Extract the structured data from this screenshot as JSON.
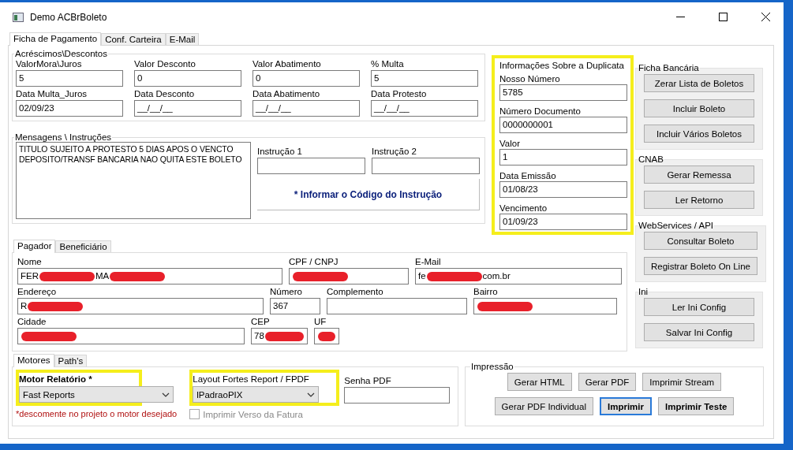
{
  "window": {
    "title": "Demo ACBrBoleto"
  },
  "tabs": [
    {
      "label": "Ficha de Pagamento",
      "selected": true
    },
    {
      "label": "Conf. Carteira",
      "selected": false
    },
    {
      "label": "E-Mail",
      "selected": false
    }
  ],
  "acrescimos": {
    "title": "Acréscimos\\Descontos",
    "fields": [
      {
        "label": "ValorMora\\Juros",
        "value": "5"
      },
      {
        "label": "Valor Desconto",
        "value": "0"
      },
      {
        "label": "Valor Abatimento",
        "value": "0"
      },
      {
        "label": "% Multa",
        "value": "5"
      },
      {
        "label": "Data Multa_Juros",
        "value": "02/09/23"
      },
      {
        "label": "Data Desconto",
        "value": "__/__/__"
      },
      {
        "label": "Data Abatimento",
        "value": "__/__/__"
      },
      {
        "label": "Data Protesto",
        "value": "__/__/__"
      }
    ]
  },
  "mensagens": {
    "title": "Mensagens \\ Instruções",
    "lines": [
      "TITULO SUJEITO A PROTESTO 5 DIAS APOS O VENCTO",
      "DEPOSITO/TRANSF BANCARIA NAO QUITA ESTE BOLETO"
    ],
    "instrucoes": [
      {
        "label": "Instrução 1"
      },
      {
        "label": "Instrução 2"
      }
    ],
    "note": "* Informar o Código do Instrução"
  },
  "duplicata": {
    "title": "Informações Sobre a Duplicata",
    "highlighted": true,
    "fields": [
      {
        "label": "Nosso Número",
        "value": "5785"
      },
      {
        "label": "Número Documento",
        "value": "0000000001"
      },
      {
        "label": "Valor",
        "value": "1"
      },
      {
        "label": "Data Emissão",
        "value": "01/08/23"
      },
      {
        "label": "Vencimento",
        "value": "01/09/23"
      }
    ]
  },
  "side_groups": [
    {
      "title": "Ficha Bancária",
      "buttons": [
        "Zerar Lista de Boletos",
        "Incluir Boleto",
        "Incluir Vários Boletos"
      ]
    },
    {
      "title": "CNAB",
      "buttons": [
        "Gerar Remessa",
        "Ler Retorno"
      ]
    },
    {
      "title": "WebServices / API",
      "buttons": [
        "Consultar Boleto",
        "Registrar Boleto On Line"
      ]
    },
    {
      "title": "Ini",
      "buttons": [
        "Ler Ini Config",
        "Salvar Ini Config"
      ]
    }
  ],
  "pagador": {
    "tabs": [
      {
        "label": "Pagador",
        "selected": true
      },
      {
        "label": "Beneficiário",
        "selected": false
      }
    ],
    "fields": [
      {
        "label": "Nome",
        "segments": [
          {
            "kind": "text",
            "text": "FER"
          },
          {
            "kind": "redaction"
          },
          {
            "kind": "text",
            "text": "MA"
          },
          {
            "kind": "redaction"
          }
        ]
      },
      {
        "label": "CPF / CNPJ",
        "segments": [
          {
            "kind": "redaction"
          }
        ]
      },
      {
        "label": "E-Mail",
        "segments": [
          {
            "kind": "text",
            "text": "fe"
          },
          {
            "kind": "redaction"
          },
          {
            "kind": "text",
            "text": "com.br"
          }
        ]
      },
      {
        "label": "Endereço",
        "segments": [
          {
            "kind": "text",
            "text": "R"
          },
          {
            "kind": "redaction"
          }
        ]
      },
      {
        "label": "Número",
        "segments": [
          {
            "kind": "text",
            "text": "367"
          }
        ]
      },
      {
        "label": "Complemento"
      },
      {
        "label": "Bairro",
        "segments": [
          {
            "kind": "redaction"
          }
        ]
      },
      {
        "label": "Cidade",
        "segments": [
          {
            "kind": "redaction"
          }
        ]
      },
      {
        "label": "CEP",
        "segments": [
          {
            "kind": "text",
            "text": "78"
          },
          {
            "kind": "redaction"
          }
        ]
      },
      {
        "label": "UF",
        "segments": [
          {
            "kind": "redaction"
          }
        ]
      }
    ]
  },
  "motores": {
    "tabs": [
      {
        "label": "Motores",
        "selected": true
      },
      {
        "label": "Path's",
        "selected": false
      }
    ],
    "motor": {
      "label": "Motor Relatório *",
      "value": "Fast Reports",
      "highlighted": true
    },
    "hint": "*descomente no projeto o motor desejado",
    "layout": {
      "label": "Layout Fortes Report / FPDF",
      "value": "lPadraoPIX",
      "highlighted": true
    },
    "senha": {
      "label": "Senha PDF"
    },
    "verso": {
      "label": "Imprimir Verso da Fatura",
      "checked": false
    }
  },
  "impressao": {
    "title": "Impressão",
    "rows": [
      [
        {
          "label": "Gerar HTML",
          "bold": false,
          "focused": false
        },
        {
          "label": "Gerar PDF",
          "bold": false,
          "focused": false
        },
        {
          "label": "Imprimir Stream",
          "bold": false,
          "focused": false
        }
      ],
      [
        {
          "label": "Gerar PDF Individual",
          "bold": false,
          "focused": false
        },
        {
          "label": "Imprimir",
          "bold": true,
          "focused": true
        },
        {
          "label": "Imprimir Teste",
          "bold": true,
          "focused": false
        }
      ]
    ]
  }
}
